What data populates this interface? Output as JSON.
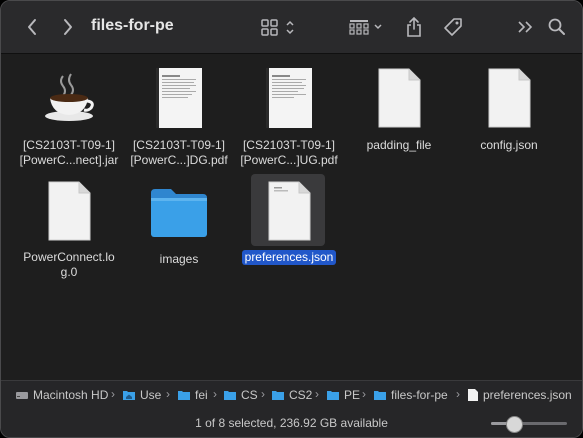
{
  "window": {
    "title": "files-for-pe"
  },
  "toolbar": {
    "back_icon": "chevron-left-icon",
    "forward_icon": "chevron-right-icon",
    "view_icon": "icon-grid-view-icon",
    "group_icon": "group-by-icon",
    "share_icon": "share-icon",
    "tag_icon": "tag-icon",
    "more_icon": "double-chevron-right-icon",
    "search_icon": "search-icon"
  },
  "files": [
    {
      "name_line1": "[CS2103T-T09-1]",
      "name_line2": "[PowerC...nect].jar",
      "kind": "jar"
    },
    {
      "name_line1": "[CS2103T-T09-1]",
      "name_line2": "[PowerC...]DG.pdf",
      "kind": "pdf"
    },
    {
      "name_line1": "[CS2103T-T09-1]",
      "name_line2": "[PowerC...]UG.pdf",
      "kind": "pdf"
    },
    {
      "name_line1": "padding_file",
      "name_line2": "",
      "kind": "document"
    },
    {
      "name_line1": "config.json",
      "name_line2": "",
      "kind": "document"
    },
    {
      "name_line1": "PowerConnect.lo",
      "name_line2": "g.0",
      "kind": "document"
    },
    {
      "name_line1": "images",
      "name_line2": "",
      "kind": "folder"
    },
    {
      "name_line1": "preferences.json",
      "name_line2": "",
      "kind": "document",
      "selected": true
    }
  ],
  "path": [
    {
      "label": "Macintosh HD",
      "icon": "hard-drive-icon"
    },
    {
      "label": "Use",
      "icon": "home-folder-icon"
    },
    {
      "label": "fei",
      "icon": "folder-icon"
    },
    {
      "label": "CS",
      "icon": "folder-icon"
    },
    {
      "label": "CS2",
      "icon": "folder-icon"
    },
    {
      "label": "PE",
      "icon": "folder-icon"
    },
    {
      "label": "files-for-pe",
      "icon": "folder-icon"
    },
    {
      "label": "preferences.json",
      "icon": "json-file-icon"
    }
  ],
  "path_separator": "›",
  "status": {
    "text": "1 of 8 selected, 236.92 GB available",
    "icon_size_level": 0.3
  },
  "colors": {
    "selection": "#2157c9",
    "folder": "#3aa0e8",
    "background": "#1e1e1e"
  }
}
